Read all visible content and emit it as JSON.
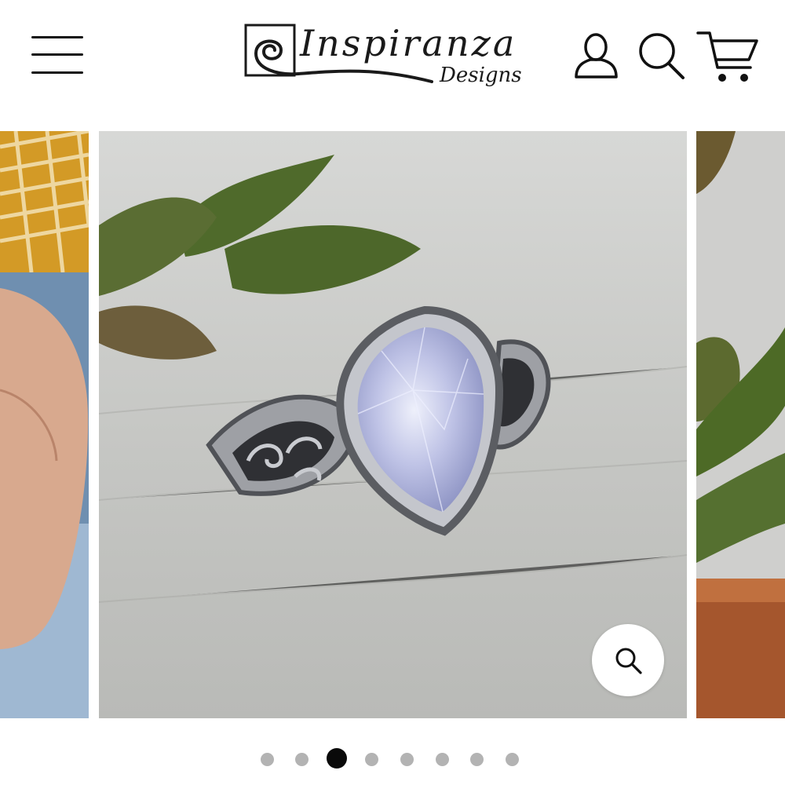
{
  "header": {
    "brand_name": "Inspiranza",
    "brand_sub": "Designs",
    "icons": [
      "menu-icon",
      "account-icon",
      "search-icon",
      "cart-icon"
    ]
  },
  "gallery": {
    "slide_count": 8,
    "active_index": 2,
    "zoom_icon": "magnifier-icon"
  },
  "colors": {
    "icon": "#111111",
    "dot_inactive": "#b3b3b3",
    "dot_active": "#0a0a0a"
  }
}
